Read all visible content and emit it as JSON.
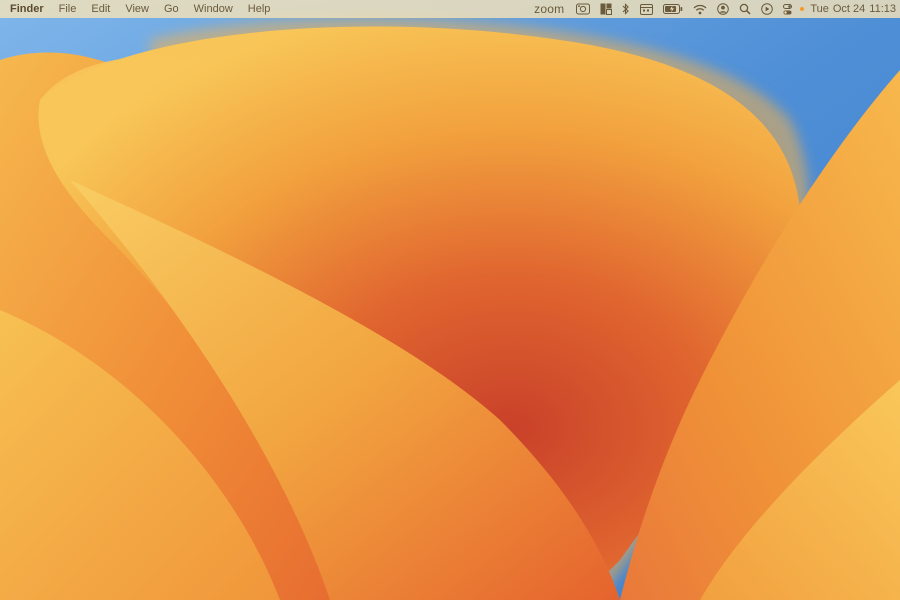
{
  "menubar": {
    "app_name": "Finder",
    "menus": [
      "File",
      "Edit",
      "View",
      "Go",
      "Window",
      "Help"
    ],
    "status_items": {
      "zoom_label": "zoom",
      "icons": [
        "photo-booth-icon",
        "window-layout-icon",
        "bluetooth-icon",
        "calendar-icon",
        "battery-icon",
        "wifi-icon",
        "user-account-icon",
        "spotlight-search-icon",
        "play-icon",
        "control-center-icon"
      ],
      "recording_indicator_color": "#f29a2e"
    },
    "clock": {
      "day": "Tue",
      "date": "Oct 24",
      "time": "11:13"
    }
  },
  "wallpaper": {
    "colors": {
      "sky_blue": "#4f8fd6",
      "petal_light": "#f7c45a",
      "petal_orange": "#f0a23c",
      "petal_deep": "#d9542a"
    }
  }
}
